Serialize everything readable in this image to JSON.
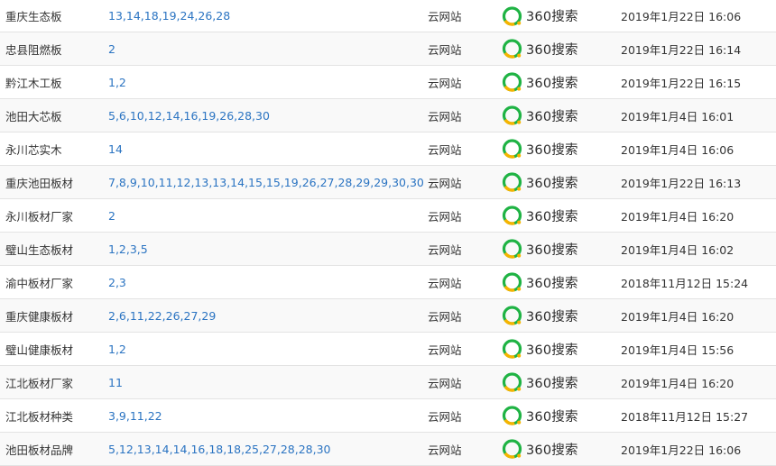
{
  "engine_label": "360搜索",
  "engine_icon": "360-search-logo-icon",
  "colors": {
    "link": "#2b74c2",
    "logo_green": "#1fb344",
    "logo_yellow": "#f6b400",
    "border": "#e3e3e3"
  },
  "rows": [
    {
      "keyword": "重庆生态板",
      "rank": "13,14,18,19,24,26,28",
      "site": "云网站",
      "date": "2019年1月22日 16:06"
    },
    {
      "keyword": "忠县阻燃板",
      "rank": "2",
      "site": "云网站",
      "date": "2019年1月22日 16:14"
    },
    {
      "keyword": "黔江木工板",
      "rank": "1,2",
      "site": "云网站",
      "date": "2019年1月22日 16:15"
    },
    {
      "keyword": "池田大芯板",
      "rank": "5,6,10,12,14,16,19,26,28,30",
      "site": "云网站",
      "date": "2019年1月4日 16:01"
    },
    {
      "keyword": "永川芯实木",
      "rank": "14",
      "site": "云网站",
      "date": "2019年1月4日 16:06"
    },
    {
      "keyword": "重庆池田板材",
      "rank": "7,8,9,10,11,12,13,13,14,15,15,19,26,27,28,29,29,30,30",
      "site": "云网站",
      "date": "2019年1月22日 16:13"
    },
    {
      "keyword": "永川板材厂家",
      "rank": "2",
      "site": "云网站",
      "date": "2019年1月4日 16:20"
    },
    {
      "keyword": "璧山生态板材",
      "rank": "1,2,3,5",
      "site": "云网站",
      "date": "2019年1月4日 16:02"
    },
    {
      "keyword": "渝中板材厂家",
      "rank": "2,3",
      "site": "云网站",
      "date": "2018年11月12日 15:24"
    },
    {
      "keyword": "重庆健康板材",
      "rank": "2,6,11,22,26,27,29",
      "site": "云网站",
      "date": "2019年1月4日 16:20"
    },
    {
      "keyword": "璧山健康板材",
      "rank": "1,2",
      "site": "云网站",
      "date": "2019年1月4日 15:56"
    },
    {
      "keyword": "江北板材厂家",
      "rank": "11",
      "site": "云网站",
      "date": "2019年1月4日 16:20"
    },
    {
      "keyword": "江北板材种类",
      "rank": "3,9,11,22",
      "site": "云网站",
      "date": "2018年11月12日 15:27"
    },
    {
      "keyword": "池田板材品牌",
      "rank": "5,12,13,14,14,16,18,18,25,27,28,28,30",
      "site": "云网站",
      "date": "2019年1月22日 16:06"
    }
  ]
}
